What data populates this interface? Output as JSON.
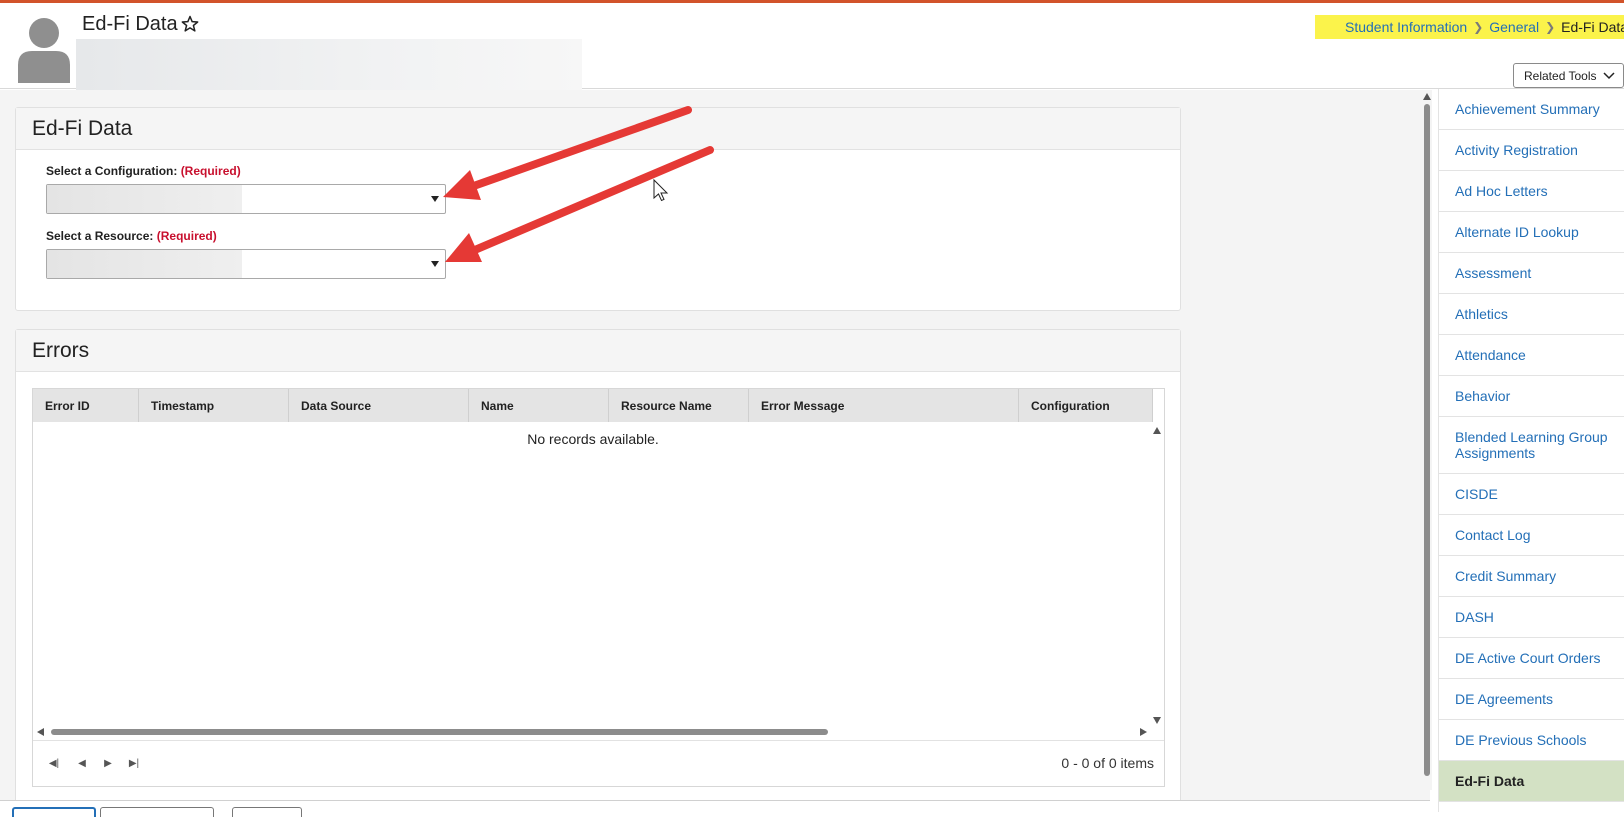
{
  "header": {
    "page_title": "Ed-Fi Data",
    "breadcrumb": [
      "Student Information",
      "General",
      "Ed-Fi Data"
    ],
    "related_tools_label": "Related Tools"
  },
  "settings_panel": {
    "title": "Ed-Fi Data",
    "configuration_label": "Select a Configuration:",
    "resource_label": "Select a Resource:",
    "required_text": "(Required)"
  },
  "errors_panel": {
    "title": "Errors",
    "columns": [
      "Error ID",
      "Timestamp",
      "Data Source",
      "Name",
      "Resource Name",
      "Error Message",
      "Configuration"
    ],
    "empty_message": "No records available.",
    "pager_info": "0 - 0 of 0 items"
  },
  "sidebar": {
    "items": [
      "Achievement Summary",
      "Activity Registration",
      "Ad Hoc Letters",
      "Alternate ID Lookup",
      "Assessment",
      "Athletics",
      "Attendance",
      "Behavior",
      "Blended Learning Group Assignments",
      "CISDE",
      "Contact Log",
      "Credit Summary",
      "DASH",
      "DE Active Court Orders",
      "DE Agreements",
      "DE Previous Schools",
      "Ed-Fi Data"
    ],
    "active_item": "Ed-Fi Data"
  },
  "colors": {
    "accent_bar": "#d2532a",
    "breadcrumb_highlight": "#fbf34b",
    "link": "#236fb7",
    "required": "#c8102e",
    "annotation_arrow": "#e53935",
    "active_sidebar": "#d3e1c4"
  }
}
